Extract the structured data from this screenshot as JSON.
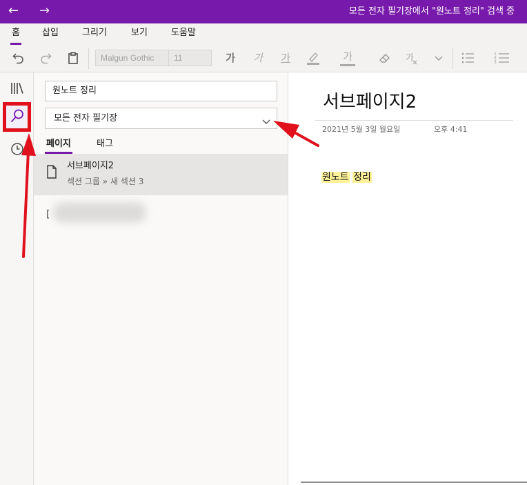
{
  "titlebar": {
    "title": "모든 전자 필기장에서 \"원노트 정리\" 검색 중",
    "back_icon": "←",
    "forward_icon": "→"
  },
  "ribbon": {
    "tabs": [
      {
        "label": "홈",
        "active": true
      },
      {
        "label": "삽입"
      },
      {
        "label": "그리기"
      },
      {
        "label": "보기"
      },
      {
        "label": "도움말"
      }
    ],
    "font_name": "Malgun Gothic",
    "font_size": "11",
    "format_glyph": "가"
  },
  "search": {
    "query": "원노트 정리",
    "scope": "모든 전자 필기장",
    "tabs": [
      {
        "label": "페이지",
        "active": true
      },
      {
        "label": "태그"
      }
    ],
    "results": [
      {
        "title": "서브페이지2",
        "path": "섹션 그룹 » 새 섹션 3"
      }
    ]
  },
  "page": {
    "title": "서브페이지2",
    "date": "2021년 5월 3일 월요일",
    "time": "오후 4:41",
    "highlight_words": [
      "원노트",
      "정리"
    ]
  },
  "colors": {
    "accent": "#7719aa",
    "annotation": "#e0111d",
    "highlight": "#fff29a"
  },
  "icons": [
    "back-arrow-icon",
    "forward-arrow-icon",
    "undo-icon",
    "redo-icon",
    "clipboard-icon",
    "highlighter-icon",
    "eraser-icon",
    "clear-format-icon",
    "bullet-list-icon",
    "numbered-list-icon",
    "notebooks-icon",
    "search-icon",
    "recent-icon",
    "page-icon",
    "chevron-down-icon"
  ]
}
